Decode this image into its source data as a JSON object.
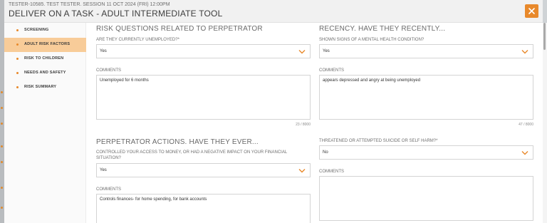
{
  "colors": {
    "accent": "#e8892b",
    "active_nav_bg": "#f8cc99"
  },
  "header": {
    "meta": "TESTER-10585. TEST TESTER. SESSION 11 OCT 2024 (FRI) 12:00PM",
    "title": "DELIVER ON A TASK - ADULT INTERMEDIATE TOOL",
    "close_icon": "close-icon"
  },
  "sidebar": {
    "items": [
      {
        "label": "SCREENING",
        "active": false
      },
      {
        "label": "ADULT RISK FACTORS",
        "active": true
      },
      {
        "label": "RISK TO CHILDREN",
        "active": false
      },
      {
        "label": "NEEDS AND SAFETY",
        "active": false
      },
      {
        "label": "RISK SUMMARY",
        "active": false
      }
    ]
  },
  "left": {
    "section1": {
      "title": "RISK QUESTIONS RELATED TO PERPETRATOR",
      "question": "ARE THEY CURRENTLY UNEMPLOYED?*",
      "answer": "Yes",
      "comments_label": "COMMENTS",
      "comments": "Unemployed for 6 months",
      "counter": "23 / 8000"
    },
    "section2": {
      "title": "PERPETRATOR ACTIONS. HAVE THEY EVER...",
      "question": "CONTROLLED YOUR ACCESS TO MONEY, OR HAD A NEGATIVE IMPACT ON YOUR FINANCIAL SITUATION?",
      "answer": "Yes",
      "comments_label": "COMMENTS",
      "comments": "Controls finances- for home spending, for bank accounts"
    }
  },
  "right": {
    "section1": {
      "title": "RECENCY. HAVE THEY RECENTLY...",
      "question": "SHOWN SIGNS OF A MENTAL HEALTH CONDITION?",
      "answer": "Yes",
      "comments_label": "COMMENTS",
      "comments": "appears depressed and angry at being unemployed",
      "counter": "47 / 8000"
    },
    "section2": {
      "question": "THREATENED OR ATTEMPTED SUICIDE OR SELF HARM?*",
      "answer": "No",
      "comments_label": "COMMENTS",
      "comments": ""
    }
  }
}
